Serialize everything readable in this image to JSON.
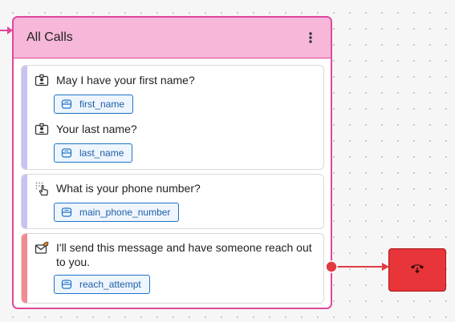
{
  "node": {
    "title": "All Calls",
    "menu_icon": "kebab-menu-icon",
    "colors": {
      "border": "#e0479a",
      "header": "#f6b7d8"
    }
  },
  "cards": [
    {
      "accent": "#c6c3f3",
      "rows": [
        {
          "icon": "contact-card-icon",
          "text": "May I have your first name?",
          "variable": "first_name"
        },
        {
          "icon": "contact-card-icon",
          "text": "Your last name?",
          "variable": "last_name"
        }
      ]
    },
    {
      "accent": "#c6c3f3",
      "rows": [
        {
          "icon": "keypad-touch-icon",
          "text": "What is your phone number?",
          "variable": "main_phone_number"
        }
      ]
    },
    {
      "accent": "#f18b90",
      "rows": [
        {
          "icon": "message-handoff-icon",
          "text": "I'll send this message and have someone reach out to you.",
          "variable": "reach_attempt"
        }
      ]
    }
  ],
  "variable_icon": "database-icon",
  "hangup": {
    "icon": "hang-up-phone-icon",
    "color": "#e8353a"
  },
  "connector_color": "#e23b44"
}
